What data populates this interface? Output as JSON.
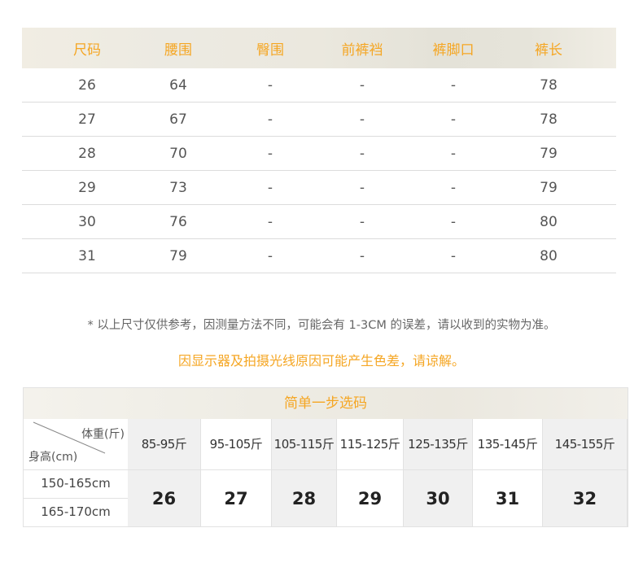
{
  "size_table": {
    "headers": [
      "尺码",
      "腰围",
      "臀围",
      "前裤裆",
      "裤脚口",
      "裤长"
    ],
    "rows": [
      [
        "26",
        "64",
        "-",
        "-",
        "-",
        "78"
      ],
      [
        "27",
        "67",
        "-",
        "-",
        "-",
        "78"
      ],
      [
        "28",
        "70",
        "-",
        "-",
        "-",
        "79"
      ],
      [
        "29",
        "73",
        "-",
        "-",
        "-",
        "79"
      ],
      [
        "30",
        "76",
        "-",
        "-",
        "-",
        "80"
      ],
      [
        "31",
        "79",
        "-",
        "-",
        "-",
        "80"
      ]
    ]
  },
  "note": "* 以上尺寸仅供参考，因测量方法不同，可能会有 1-3CM 的误差，请以收到的实物为准。",
  "color_warning": "因显示器及拍摄光线原因可能产生色差，请谅解。",
  "quick_select": {
    "title": "简单一步选码",
    "weight_header": "体重(斤)",
    "height_header": "身高(cm)",
    "weights": [
      "85-95斤",
      "95-105斤",
      "105-115斤",
      "115-125斤",
      "125-135斤",
      "135-145斤",
      "145-155斤"
    ],
    "sizes": [
      "26",
      "27",
      "28",
      "29",
      "30",
      "31",
      "32"
    ],
    "heights": [
      "150-165cm",
      "165-170cm"
    ]
  }
}
